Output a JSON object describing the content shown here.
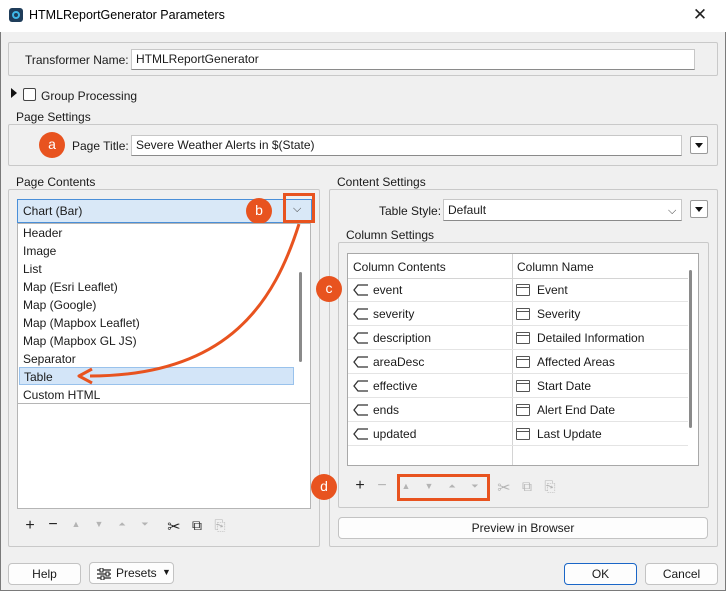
{
  "window": {
    "title": "HTMLReportGenerator Parameters",
    "close_glyph": "✕"
  },
  "transformer": {
    "label": "Transformer Name:",
    "value": "HTMLReportGenerator"
  },
  "group_processing": {
    "label": "Group Processing",
    "checked": false
  },
  "page_settings": {
    "group_label": "Page Settings",
    "page_title_label": "Page Title:",
    "page_title_value": "Severe Weather Alerts in $(State)"
  },
  "page_contents": {
    "group_label": "Page Contents",
    "selected": "Chart (Bar)",
    "options": [
      "Header",
      "Image",
      "List",
      "Map (Esri Leaflet)",
      "Map (Google)",
      "Map (Mapbox Leaflet)",
      "Map (Mapbox GL JS)",
      "Separator",
      "Table",
      "Custom HTML"
    ],
    "highlighted_option": "Table"
  },
  "content_settings": {
    "group_label": "Content Settings",
    "table_style_label": "Table Style:",
    "table_style_value": "Default",
    "column_settings_label": "Column Settings",
    "columns_header": [
      "Column Contents",
      "Column Name"
    ],
    "rows": [
      {
        "content": "event",
        "name": "Event"
      },
      {
        "content": "severity",
        "name": "Severity"
      },
      {
        "content": "description",
        "name": "Detailed Information"
      },
      {
        "content": "areaDesc",
        "name": "Affected Areas"
      },
      {
        "content": "effective",
        "name": "Start Date"
      },
      {
        "content": "ends",
        "name": "Alert End Date"
      },
      {
        "content": "updated",
        "name": "Last Update"
      }
    ],
    "preview_button": "Preview in Browser"
  },
  "annotations": {
    "a": "a",
    "b": "b",
    "c": "c",
    "d": "d",
    "accent_color": "#e8531f"
  },
  "footer": {
    "help": "Help",
    "presets": "Presets",
    "ok": "OK",
    "cancel": "Cancel"
  }
}
